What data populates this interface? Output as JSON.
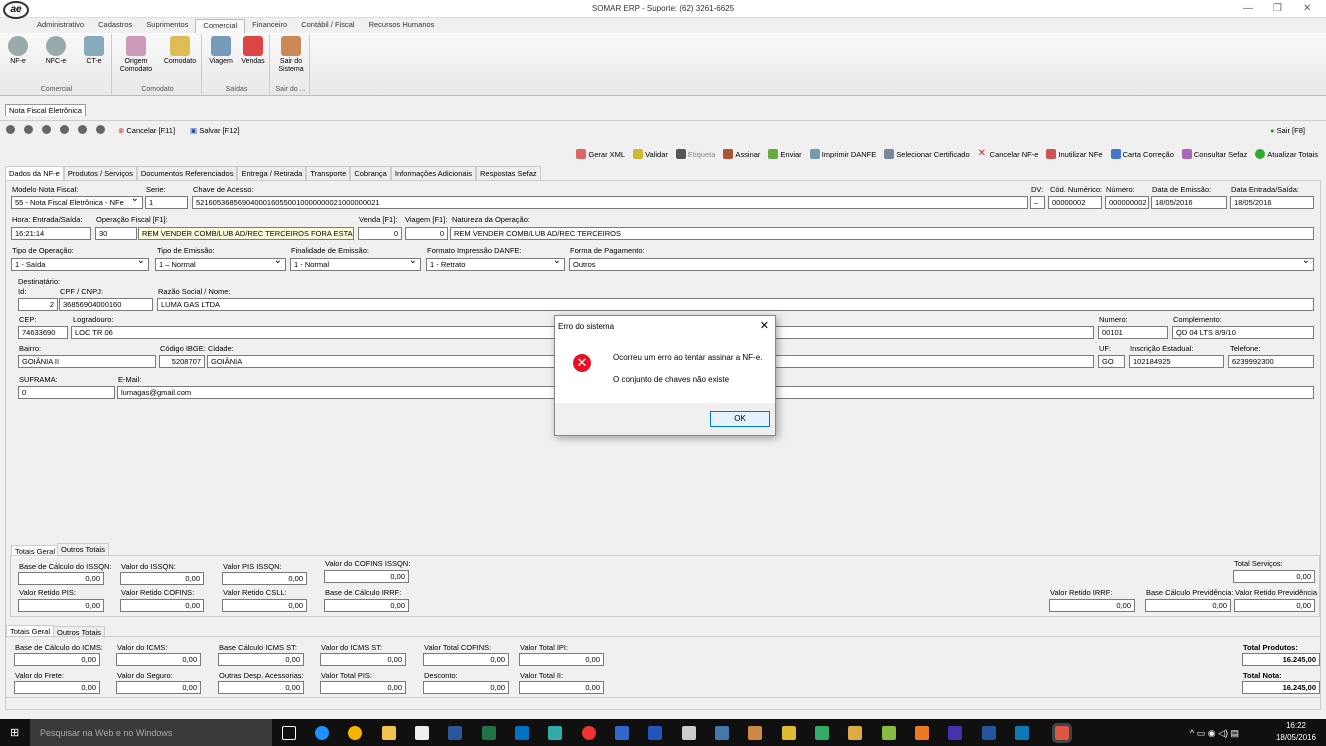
{
  "window": {
    "title": "SOMAR ERP - Suporte: (62) 3261-6625",
    "logo": "ae"
  },
  "menu": [
    "Administrativo",
    "Cadastros",
    "Suprimentos",
    "Comercial",
    "Financeiro",
    "Contábil / Fiscal",
    "Recursos Humanos"
  ],
  "ribbon": {
    "groups": [
      {
        "title": "Comercial"
      },
      {
        "title": "Comodato"
      },
      {
        "title": "Saídas"
      },
      {
        "title": "Sair do ..."
      }
    ],
    "buttons": [
      "NF-e",
      "NFC-e",
      "CT-e",
      "Origem Comodato",
      "Comodato",
      "Viagem",
      "Vendas",
      "Sair do Sistema"
    ]
  },
  "doc_tab": "Nota Fiscal Eletrônica",
  "toolbar": {
    "cancel": "Cancelar [F11]",
    "save": "Salvar [F12]",
    "exit": "Sair [F8]"
  },
  "actions": [
    "Gerar XML",
    "Validar",
    "Etiqueta",
    "Assinar",
    "Enviar",
    "Imprimir DANFE",
    "Selecionar Certificado",
    "Cancelar NF-e",
    "Inutilizar NFe",
    "Carta Correção",
    "Consultar Sefaz",
    "Atualizar Totais"
  ],
  "tabs": [
    "Dados da NF-e",
    "Produtos / Serviços",
    "Documentos Referenciados",
    "Entrega / Retirada",
    "Transporte",
    "Cobrança",
    "Informações Adicionais",
    "Respostas Sefaz"
  ],
  "form": {
    "modelo_lbl": "Modelo Nota Fiscal:",
    "modelo": "55 - Nota Fiscal Eletrônica - NFe",
    "serie_lbl": "Serie:",
    "serie": "1",
    "chave_lbl": "Chave de Acesso:",
    "chave": "52160536856904000160550010000000021000000021",
    "dv_lbl": "DV:",
    "dv": "–",
    "codnum_lbl": "Cód. Numérico:",
    "codnum": "00000002",
    "numero_lbl": "Número:",
    "numero": "000000002",
    "emissao_lbl": "Data de Emissão:",
    "emissao": "18/05/2016",
    "entrada_lbl": "Data Entrada/Saída:",
    "entrada": "18/05/2016",
    "hora_lbl": "Hora: Entrada/Saída:",
    "hora": "16:21:14",
    "opfiscal_lbl": "Operação Fiscal [F1]:",
    "opfiscal_cod": "30",
    "opfiscal": "REM VENDER COMB/LUB AD/REC TERCEIROS FORA ESTABELEC",
    "venda_lbl": "Venda [F1]:",
    "venda": "0",
    "viagem_lbl": "Viagem [F1]:",
    "viagem": "0",
    "natureza_lbl": "Natureza da Operação:",
    "natureza": "REM VENDER COMB/LUB AD/REC TERCEIROS",
    "tipoop_lbl": "Tipo de Operação:",
    "tipoop": "1 - Saída",
    "tipoem_lbl": "Tipo de Emissão:",
    "tipoem": "1 – Normal",
    "final_lbl": "Finalidade de Emissão:",
    "final": "1 - Normal",
    "formato_lbl": "Formato Impressão DANFE:",
    "formato": "1 - Retrato",
    "pgto_lbl": "Forma de Pagamento:",
    "pgto": "Outros",
    "dest_lbl": "Destinatário:",
    "id_lbl": "Id:",
    "id": "2",
    "cpf_lbl": "CPF / CNPJ:",
    "cpf": "36856904000160",
    "razao_lbl": "Razão Social / Nome:",
    "razao": "LUMA GAS LTDA",
    "cep_lbl": "CEP:",
    "cep": "74633690",
    "logr_lbl": "Logradouro:",
    "logr": "LOC TR 06",
    "num_lbl": "Numero:",
    "num": "00101",
    "compl_lbl": "Complemento:",
    "compl": "QD 04 LTS 8/9/10",
    "bairro_lbl": "Bairro:",
    "bairro": "GOIÂNIA II",
    "ibge_lbl": "Código IBGE:",
    "ibge": "5208707",
    "cidade_lbl": "Cidade:",
    "cidade": "GOIÂNIA",
    "uf_lbl": "UF:",
    "uf": "GO",
    "ie_lbl": "Inscrição Estadual:",
    "ie": "102184925",
    "tel_lbl": "Telefone:",
    "tel": "6239992300",
    "suframa_lbl": "SUFRAMA:",
    "suframa": "0",
    "email_lbl": "E-Mail:",
    "email": "lumagas@gmail.com"
  },
  "totals_tabs1": [
    "Totais Geral",
    "Outros Totais"
  ],
  "iss": {
    "base_lbl": "Base de Cálculo do ISSQN:",
    "base": "0,00",
    "valor_lbl": "Valor do ISSQN:",
    "valor": "0,00",
    "pis_lbl": "Valor PIS ISSQN:",
    "pis": "0,00",
    "cofins_lbl": "Valor do COFINS ISSQN:",
    "cofins": "0,00",
    "servicos_lbl": "Total Serviços:",
    "servicos": "0,00",
    "retpis_lbl": "Valor Retido PIS:",
    "retpis": "0,00",
    "retcofins_lbl": "Valor Retido COFINS:",
    "retcofins": "0,00",
    "retcsll_lbl": "Valor Retido CSLL:",
    "retcsll": "0,00",
    "baseirrf_lbl": "Base de Cálculo IRRF:",
    "baseirrf": "0,00",
    "retirrf_lbl": "Valor Retido IRRF:",
    "retirrf": "0,00",
    "baseprev_lbl": "Base Cálculo Previdência:",
    "baseprev": "0,00",
    "retprev_lbl": "Valor Retido Previdência",
    "retprev": "0,00"
  },
  "totals_tabs2": [
    "Totais Geral",
    "Outros Totais"
  ],
  "icms": {
    "base_lbl": "Base de Cálculo do ICMS:",
    "base": "0,00",
    "valor_lbl": "Valor do ICMS:",
    "valor": "0,00",
    "basest_lbl": "Base Cálculo ICMS ST:",
    "basest": "0,00",
    "valst_lbl": "Valor do ICMS ST:",
    "valst": "0,00",
    "cofins_lbl": "Valor Total COFINS:",
    "cofins": "0,00",
    "ipi_lbl": "Valor Total IPI:",
    "ipi": "0,00",
    "frete_lbl": "Valor do Frete:",
    "frete": "0,00",
    "seguro_lbl": "Valor do Seguro:",
    "seguro": "0,00",
    "outras_lbl": "Outras Desp. Acessorias:",
    "outras": "0,00",
    "pis_lbl": "Valor Total PIS:",
    "pis": "0,00",
    "desconto_lbl": "Desconto:",
    "desconto": "0,00",
    "ii_lbl": "Valor Total II:",
    "ii": "0,00",
    "prod_lbl": "Total Produtos:",
    "prod": "16.245,00",
    "nota_lbl": "Total Nota:",
    "nota": "16.245,00"
  },
  "dialog": {
    "title": "Erro do sistema",
    "msg1": "Ocorreu um erro ao tentar assinar a NF-e.",
    "msg2": "O conjunto de chaves não existe",
    "ok": "OK"
  },
  "taskbar": {
    "search": "Pesquisar na Web e no Windows",
    "time": "16:22",
    "date": "18/05/2016"
  }
}
